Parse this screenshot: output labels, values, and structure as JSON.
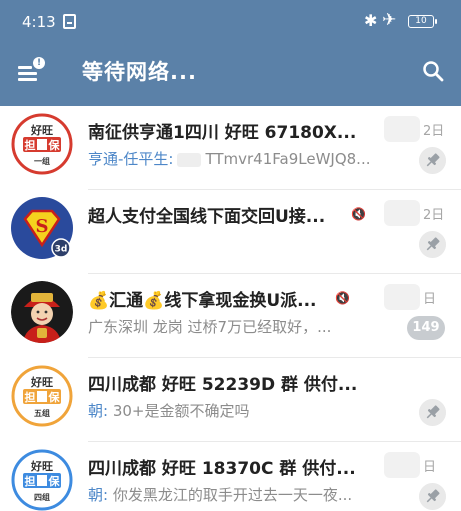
{
  "status_bar": {
    "time": "4:13",
    "battery": "10"
  },
  "header": {
    "title": "等待网络..."
  },
  "chats": [
    {
      "name": "南征供亨通1四川 好旺 67180X...",
      "date": "2日",
      "sender": "亨通-任平生:",
      "preview": "TTmvr41Fa9LeWJQ8...",
      "pinned": true,
      "avatar": "haowang-stamp",
      "avatar_text": {
        "top": "好旺",
        "left": "担",
        "right": "保",
        "bottom": "一组"
      }
    },
    {
      "name": "超人支付全国线下面交回U接...",
      "date": "2日",
      "sender": "",
      "preview": "",
      "muted": true,
      "pinned": true,
      "avatar": "superman-logo",
      "avatar_badge": "3d"
    },
    {
      "name": "💰汇通💰线下拿现金换U派...",
      "date": "日",
      "sender": "",
      "preview": "广东深圳 龙岗   过桥7万已经取好，...",
      "muted": true,
      "unread": "149",
      "avatar": "fortune-god"
    },
    {
      "name": "四川成都 好旺 52239D 群 供付...",
      "date": "",
      "sender": "朝:",
      "preview": "30+是金额不确定吗",
      "pinned": true,
      "avatar": "haowang-stamp",
      "avatar_text": {
        "top": "好旺",
        "left": "担",
        "right": "保",
        "bottom": "五组"
      }
    },
    {
      "name": "四川成都 好旺 18370C 群 供付...",
      "date": "日",
      "sender": "朝:",
      "preview": "你发黑龙江的取手开过去一天一夜...",
      "pinned": true,
      "avatar": "haowang-stamp",
      "avatar_text": {
        "top": "好旺",
        "left": "担",
        "right": "保",
        "bottom": "四组"
      }
    }
  ],
  "colors": {
    "header": "#5b81a8",
    "sender": "#4d87c8",
    "stamp_red": "#d63b2f",
    "stamp_orange": "#f0a43a",
    "stamp_blue": "#3d8be0"
  }
}
